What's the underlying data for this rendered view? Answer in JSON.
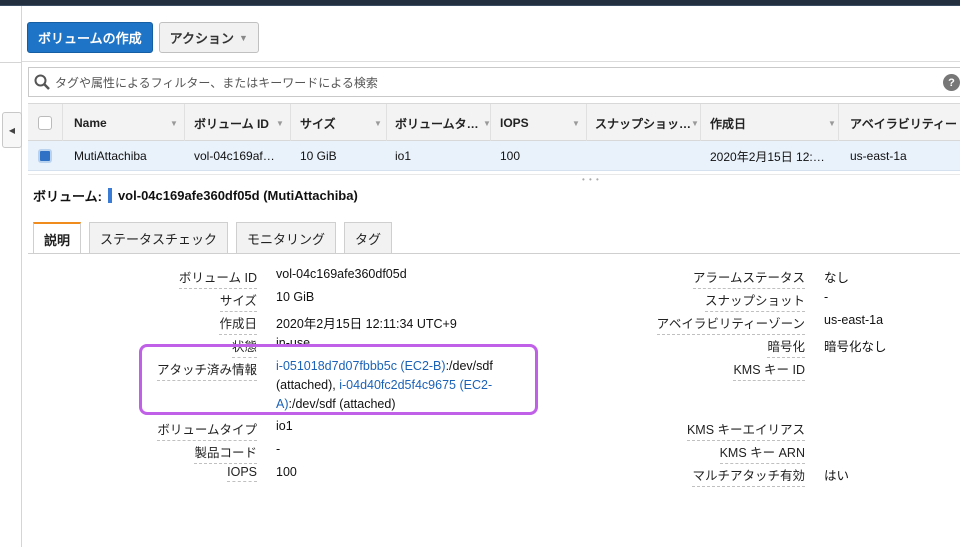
{
  "toolbar": {
    "create_label": "ボリュームの作成",
    "actions_label": "アクション"
  },
  "search": {
    "placeholder": "タグや属性によるフィルター、またはキーワードによる検索"
  },
  "table": {
    "columns": [
      "Name",
      "ボリューム ID",
      "サイズ",
      "ボリュームタ…",
      "IOPS",
      "スナップショッ…",
      "作成日",
      "アベイラビリティー"
    ],
    "row": {
      "name": "MutiAttachiba",
      "volume_id": "vol-04c169af…",
      "size": "10 GiB",
      "type": "io1",
      "iops": "100",
      "snapshot": "",
      "created": "2020年2月15日 12:…",
      "az": "us-east-1a"
    }
  },
  "detail": {
    "title_prefix": "ボリューム:",
    "title_value": "vol-04c169afe360df05d (MutiAttachiba)",
    "tabs": [
      "説明",
      "ステータスチェック",
      "モニタリング",
      "タグ"
    ],
    "left": {
      "volume_id_label": "ボリューム ID",
      "volume_id_value": "vol-04c169afe360df05d",
      "size_label": "サイズ",
      "size_value": "10 GiB",
      "created_label": "作成日",
      "created_value": "2020年2月15日 12:11:34 UTC+9",
      "state_label": "状態",
      "state_value": "in-use",
      "attach_label": "アタッチ済み情報",
      "attach_link1": "i-051018d7d07fbbb5c (EC2-B)",
      "attach_text1": ":/dev/sdf",
      "attach_text2": "(attached), ",
      "attach_link2": "i-04d40fc2d5f4c9675 (EC2-",
      "attach_link2b": "A)",
      "attach_text3": ":/dev/sdf (attached)",
      "type_label": "ボリュームタイプ",
      "type_value": "io1",
      "product_code_label": "製品コード",
      "product_code_value": "-",
      "iops_label": "IOPS",
      "iops_value": "100"
    },
    "right": {
      "alarm_label": "アラームステータス",
      "alarm_value": "なし",
      "snapshot_label": "スナップショット",
      "snapshot_value": "-",
      "az_label": "アベイラビリティーゾーン",
      "az_value": "us-east-1a",
      "encryption_label": "暗号化",
      "encryption_value": "暗号化なし",
      "kms_id_label": "KMS キー ID",
      "kms_alias_label": "KMS キーエイリアス",
      "kms_arn_label": "KMS キー ARN",
      "multi_attach_label": "マルチアタッチ有効",
      "multi_attach_value": "はい"
    }
  },
  "colors": {
    "primary": "#1e74c6",
    "highlight": "#c060e8",
    "link": "#1a62b8",
    "tab_accent": "#f08c1e"
  }
}
